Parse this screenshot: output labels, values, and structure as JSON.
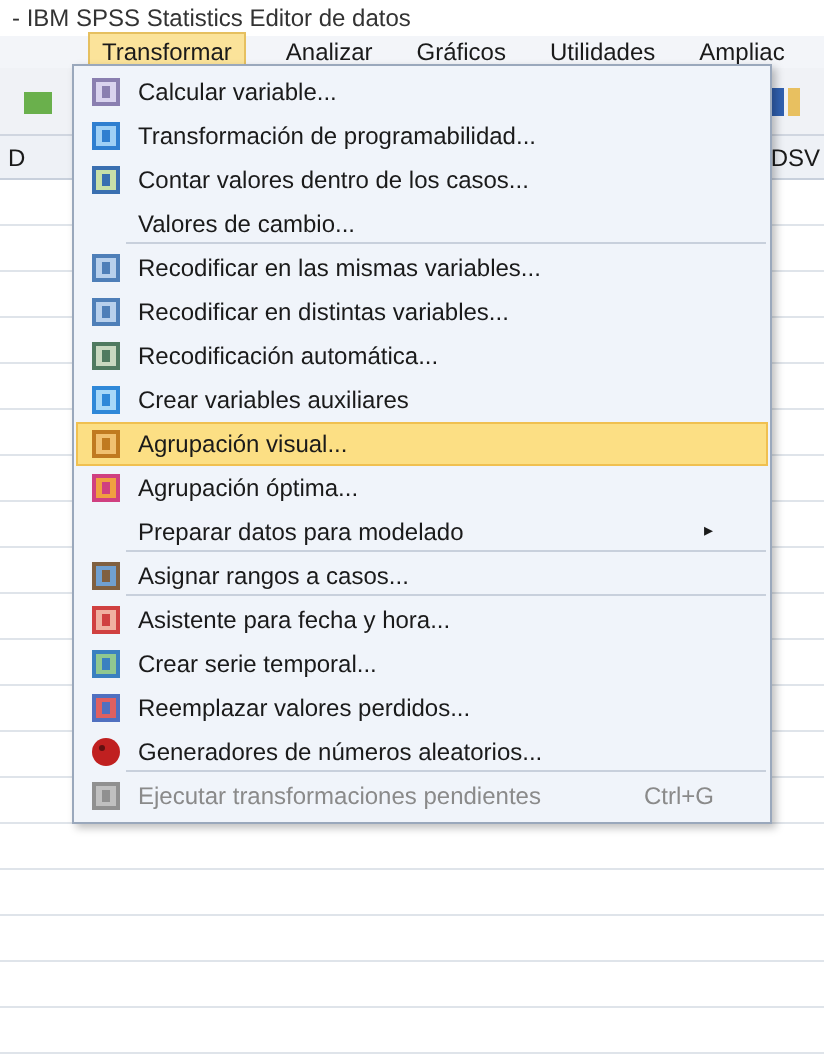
{
  "window": {
    "title": "- IBM SPSS Statistics Editor de datos"
  },
  "menubar": [
    {
      "label": "Transformar",
      "selected": true
    },
    {
      "label": "Analizar",
      "selected": false
    },
    {
      "label": "Gráficos",
      "selected": false
    },
    {
      "label": "Utilidades",
      "selected": false
    },
    {
      "label": "Ampliac",
      "selected": false
    }
  ],
  "grid": {
    "column_1": "D",
    "column_2": "DSV"
  },
  "menu": [
    {
      "label": "Calcular variable...",
      "selected": false,
      "disabled": false,
      "separator_after": false
    },
    {
      "label": "Transformación de programabilidad...",
      "selected": false,
      "disabled": false,
      "separator_after": false
    },
    {
      "label": "Contar valores dentro de los casos...",
      "selected": false,
      "disabled": false,
      "separator_after": false
    },
    {
      "label": "Valores de cambio...",
      "selected": false,
      "disabled": false,
      "separator_after": true
    },
    {
      "label": "Recodificar en las mismas variables...",
      "selected": false,
      "disabled": false,
      "separator_after": false
    },
    {
      "label": "Recodificar en distintas variables...",
      "selected": false,
      "disabled": false,
      "separator_after": false
    },
    {
      "label": "Recodificación automática...",
      "selected": false,
      "disabled": false,
      "separator_after": false
    },
    {
      "label": "Crear variables auxiliares",
      "selected": false,
      "disabled": false,
      "separator_after": false
    },
    {
      "label": "Agrupación visual...",
      "selected": true,
      "disabled": false,
      "separator_after": false
    },
    {
      "label": "Agrupación óptima...",
      "selected": false,
      "disabled": false,
      "separator_after": false
    },
    {
      "label": "Preparar datos para modelado",
      "selected": false,
      "disabled": false,
      "separator_after": true,
      "submenu": "▸"
    },
    {
      "label": "Asignar rangos a casos...",
      "selected": false,
      "disabled": false,
      "separator_after": true
    },
    {
      "label": "Asistente para fecha y hora...",
      "selected": false,
      "disabled": false,
      "separator_after": false
    },
    {
      "label": "Crear serie temporal...",
      "selected": false,
      "disabled": false,
      "separator_after": false
    },
    {
      "label": "Reemplazar valores perdidos...",
      "selected": false,
      "disabled": false,
      "separator_after": false
    },
    {
      "label": "Generadores de números aleatorios...",
      "selected": false,
      "disabled": false,
      "separator_after": true
    },
    {
      "label": "Ejecutar transformaciones pendientes",
      "selected": false,
      "disabled": true,
      "separator_after": false,
      "shortcut": "Ctrl+G"
    }
  ]
}
